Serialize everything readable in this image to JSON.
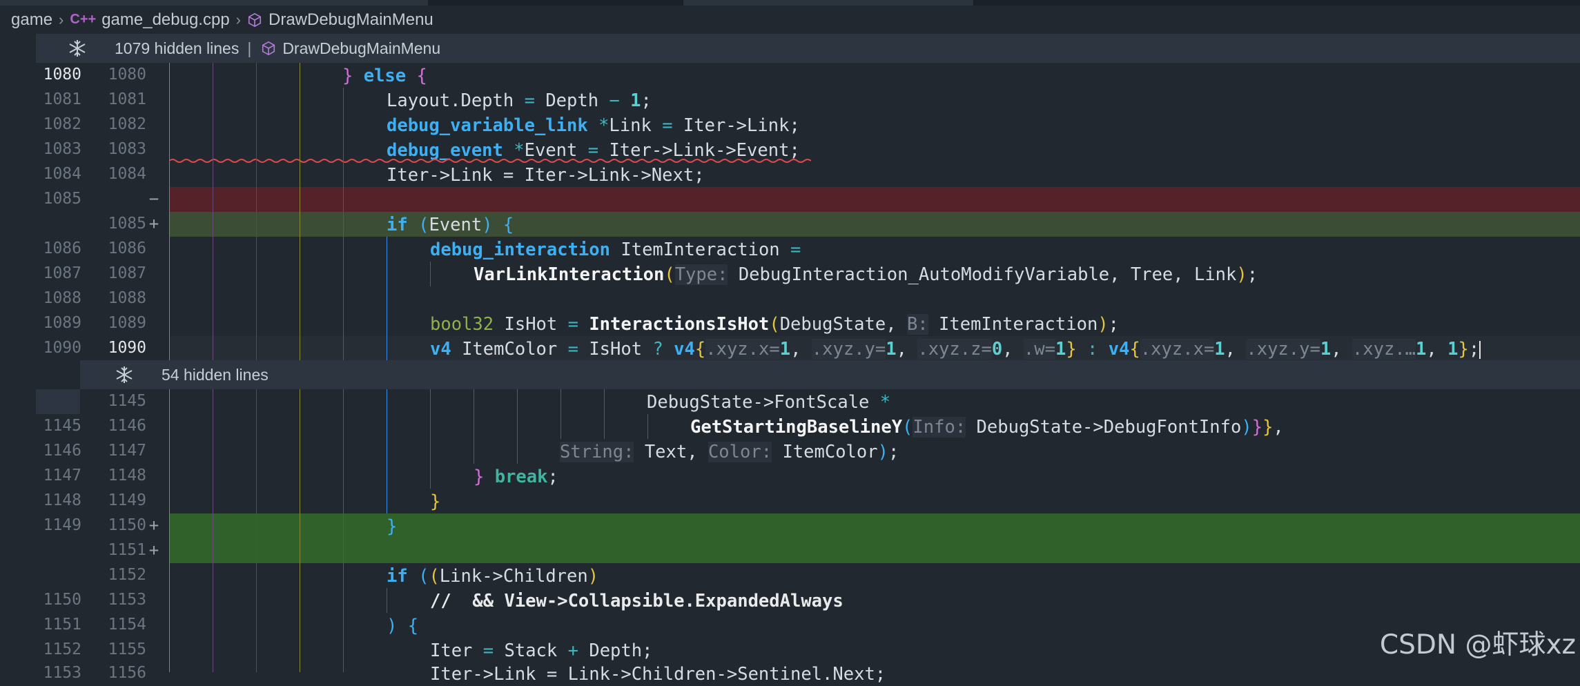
{
  "breadcrumb": {
    "folder": "game",
    "file_icon_text": "C++",
    "file": "game_debug.cpp",
    "symbol": "DrawDebugMainMenu"
  },
  "fold1": {
    "text": "1079 hidden lines",
    "separator": "|",
    "symbol": "DrawDebugMainMenu"
  },
  "fold2": {
    "text": "54 hidden lines"
  },
  "lines": {
    "l1080": {
      "left": "1080",
      "right": "1080"
    },
    "l1081": {
      "left": "1081",
      "right": "1081"
    },
    "l1082": {
      "left": "1082",
      "right": "1082"
    },
    "l1083": {
      "left": "1083",
      "right": "1083"
    },
    "l1084": {
      "left": "1084",
      "right": "1084"
    },
    "l1085d": {
      "left": "1085",
      "right": "",
      "marker": "−"
    },
    "l1085a": {
      "left": "",
      "right": "1085",
      "marker": "+"
    },
    "l1086": {
      "left": "1086",
      "right": "1086"
    },
    "l1087": {
      "left": "1087",
      "right": "1087"
    },
    "l1088": {
      "left": "1088",
      "right": "1088"
    },
    "l1089": {
      "left": "1089",
      "right": "1089"
    },
    "l1090": {
      "left": "1090",
      "right": "1090"
    },
    "l1145": {
      "left": "",
      "right": "1145"
    },
    "l1146": {
      "left": "1145",
      "right": "1146"
    },
    "l1147": {
      "left": "1146",
      "right": "1147"
    },
    "l1148": {
      "left": "1147",
      "right": "1148"
    },
    "l1149": {
      "left": "1148",
      "right": "1149"
    },
    "l1150": {
      "left": "1149",
      "right": "1150",
      "marker": "+"
    },
    "l1151": {
      "left": "",
      "right": "1151",
      "marker": "+"
    },
    "l1152": {
      "left": "",
      "right": "1152"
    },
    "l1153": {
      "left": "1150",
      "right": "1153"
    },
    "l1154": {
      "left": "1151",
      "right": "1154"
    },
    "l1155": {
      "left": "1152",
      "right": "1155"
    },
    "l1156": {
      "left": "1153",
      "right": "1156"
    }
  },
  "code": {
    "c1080": {
      "close": "}",
      "kw": "else",
      "open": "{"
    },
    "c1081": {
      "a": "Layout.Depth",
      "eq": "=",
      "b": "Depth",
      "op": "−",
      "num": "1",
      "end": ";"
    },
    "c1082": {
      "ty": "debug_variable_link",
      "star": "*",
      "name": "Link",
      "eq": "=",
      "rest": "Iter->Link;"
    },
    "c1083": {
      "ty": "debug_event",
      "star": "*",
      "name": "Event",
      "eq": "=",
      "rest": "Iter->Link->Event;"
    },
    "c1084": {
      "text": "Iter->Link = Iter->Link->Next;"
    },
    "c1085": {
      "kw": "if",
      "p1": "(",
      "arg": "Event",
      "p2": ")",
      "open": "{"
    },
    "c1086": {
      "ty": "debug_interaction",
      "name": "ItemInteraction",
      "eq": "="
    },
    "c1087": {
      "fn": "VarLinkInteraction",
      "p1": "(",
      "hint": "Type:",
      "args": "DebugInteraction_AutoModifyVariable, Tree, Link",
      "p2": ")",
      "end": ";"
    },
    "c1089": {
      "ty": "bool32",
      "name": "IsHot",
      "eq": "=",
      "fn": "InteractionsIsHot",
      "p1": "(",
      "a1": "DebugState,",
      "hint": "B:",
      "a2": "ItemInteraction",
      "p2": ")",
      "end": ";"
    },
    "c1090": {
      "ty": "v4",
      "name": "ItemColor",
      "eq": "=",
      "cond": "IsHot",
      "q": "?",
      "v4a": "v4",
      "ob1": "{",
      "hx1": ".xyz.x=",
      "n1": "1",
      "c1": ",",
      "hy1": ".xyz.y=",
      "n2": "1",
      "c2": ",",
      "hz1": ".xyz.z=",
      "n3": "0",
      "c3": ",",
      "hw1": ".w=",
      "n4": "1",
      "cb1": "}",
      "colon": ":",
      "v4b": "v4",
      "ob2": "{",
      "hx2": ".xyz.x=",
      "n5": "1",
      "c5": ",",
      "hy2": ".xyz.y=",
      "n6": "1",
      "c6": ",",
      "hz2": ".xyz.…",
      "n7": "1",
      "c7": ",",
      "n8": "1",
      "cb2": "}",
      "end": ";"
    },
    "c1145": {
      "text": "DebugState->FontScale",
      "op": "*"
    },
    "c1146": {
      "fn": "GetStartingBaselineY",
      "p1": "(",
      "hint": "Info:",
      "arg": "DebugState->DebugFontInfo",
      "p2": ")",
      "cb": "}",
      "end": "}",
      "comma": ","
    },
    "c1147": {
      "hint1": "String:",
      "a1": "Text,",
      "hint2": "Color:",
      "a2": "ItemColor",
      "p2": ")",
      "end": ";"
    },
    "c1148": {
      "close": "}",
      "kw": "break",
      "end": ";"
    },
    "c1149": {
      "close": "}"
    },
    "c1150": {
      "close": "}"
    },
    "c1152": {
      "kw": "if",
      "p1": "(",
      "p2": "(",
      "text": "Link->Children",
      "p3": ")"
    },
    "c1153": {
      "text": "//  && View->Collapsible.ExpandedAlways"
    },
    "c1154": {
      "p": ")",
      "open": "{"
    },
    "c1155": {
      "a": "Iter",
      "eq": "=",
      "b": "Stack",
      "op": "+",
      "c": "Depth;"
    },
    "c1156": {
      "text": "Iter->Link = Link->Children->Sentinel.Next;"
    }
  },
  "watermark": "CSDN @虾球xz",
  "colors": {
    "background": "#212830",
    "deleted_line": "#56222a",
    "added_line": "#3c4d35",
    "added_line_bright": "#31612b",
    "keyword": "#3db0f4",
    "number": "#5ad0d0"
  }
}
